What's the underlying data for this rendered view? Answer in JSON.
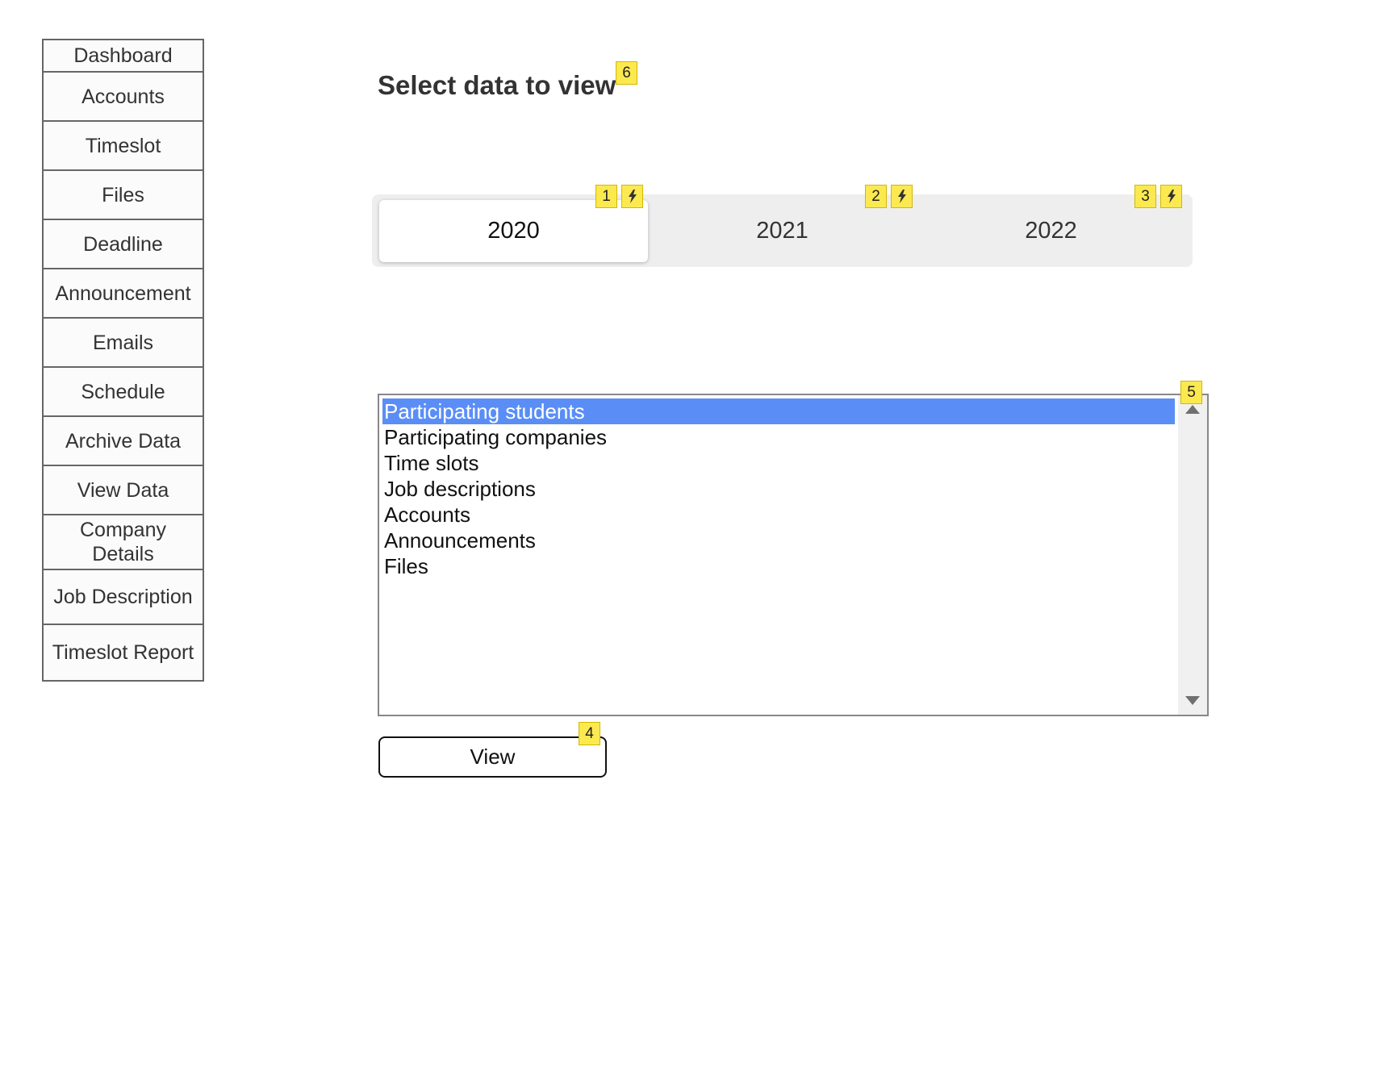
{
  "sidebar": {
    "items": [
      {
        "label": "Dashboard"
      },
      {
        "label": "Accounts"
      },
      {
        "label": "Timeslot"
      },
      {
        "label": "Files"
      },
      {
        "label": "Deadline"
      },
      {
        "label": "Announcement"
      },
      {
        "label": "Emails"
      },
      {
        "label": "Schedule"
      },
      {
        "label": "Archive Data"
      },
      {
        "label": "View Data"
      },
      {
        "label": "Company Details"
      },
      {
        "label": "Job Description"
      },
      {
        "label": "Timeslot Report"
      }
    ]
  },
  "main": {
    "title": "Select data to view",
    "years": [
      {
        "label": "2020",
        "selected": true
      },
      {
        "label": "2021",
        "selected": false
      },
      {
        "label": "2022",
        "selected": false
      }
    ],
    "data_list": {
      "selected": "Participating students",
      "options": [
        "Participating students",
        "Participating companies",
        "Time slots",
        "Job descriptions",
        "Accounts",
        "Announcements",
        "Files"
      ]
    },
    "view_button_label": "View"
  },
  "badges": {
    "title": "6",
    "year_2020": "1",
    "year_2021": "2",
    "year_2022": "3",
    "view_button": "4",
    "data_list": "5",
    "action_icon": "lightning-bolt-icon"
  },
  "colors": {
    "badge": "#fce94f",
    "selected_option": "#5a8ef6",
    "segment_track": "#eeeeee"
  }
}
